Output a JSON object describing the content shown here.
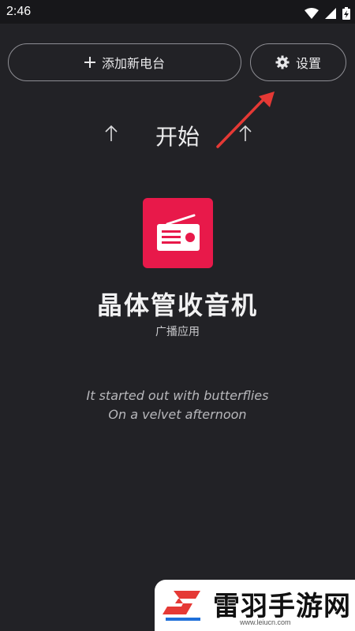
{
  "status_bar": {
    "time": "2:46",
    "icons": [
      "wifi-icon",
      "signal-icon",
      "battery-charging-icon"
    ]
  },
  "top_buttons": {
    "add_station_label": "添加新电台",
    "settings_label": "设置"
  },
  "start": {
    "label": "开始",
    "arrow_glyph": "↑"
  },
  "app": {
    "title": "晶体管收音机",
    "subtitle": "广播应用",
    "icon": "radio-icon",
    "accent_color": "#e8194a"
  },
  "lyrics": {
    "line1": "It started out with butterflies",
    "line2": "On a velvet afternoon"
  },
  "watermark": {
    "name": "雷羽手游网",
    "url": "www.leiucn.com"
  },
  "colors": {
    "background": "#222226",
    "annotation_arrow": "#e53935"
  }
}
